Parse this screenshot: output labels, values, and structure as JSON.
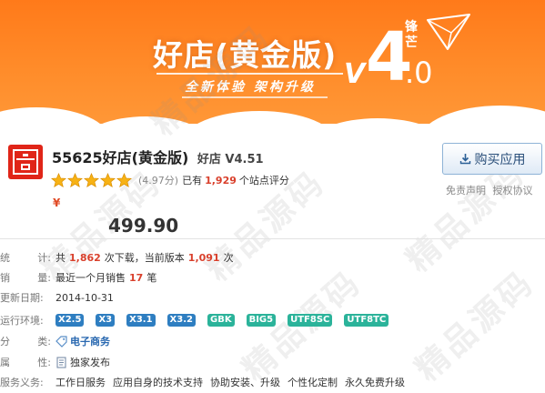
{
  "banner": {
    "title": "好店(黄金版)",
    "subtitle": "全新体验  架构升级",
    "brand": "锋芒",
    "version_v": "V",
    "version_main": "4",
    "version_minor": ".0"
  },
  "watermark": "精品源码",
  "product": {
    "name": "55625好店(黄金版)",
    "subname": "好店 V4.51",
    "rating_stars": 5,
    "score": "(4.97分)",
    "rating_prefix": "已有",
    "rating_count": "1,929",
    "rating_suffix": "个站点评分",
    "price_symbol": "¥",
    "price": "499.90"
  },
  "buy_button": {
    "label": "购买应用"
  },
  "links": {
    "disclaimer": "免责声明",
    "license": "授权协议"
  },
  "info": {
    "stats": {
      "label_a": "统",
      "label_b": "计:",
      "prefix": "共",
      "downloads": "1,862",
      "mid": "次下载，当前版本",
      "version_downloads": "1,091",
      "suffix": "次"
    },
    "sales": {
      "label_a": "销",
      "label_b": "量:",
      "prefix": "最近一个月销售",
      "count": "17",
      "suffix": "笔"
    },
    "updated": {
      "label": "更新日期:",
      "value": "2014-10-31"
    },
    "env": {
      "label": "运行环境:",
      "tags": [
        "X2.5",
        "X3",
        "X3.1",
        "X3.2",
        "GBK",
        "BIG5",
        "UTF8SC",
        "UTF8TC"
      ]
    },
    "category": {
      "label_a": "分",
      "label_b": "类:",
      "value": "电子商务"
    },
    "attribute": {
      "label_a": "属",
      "label_b": "性:",
      "value": "独家发布"
    },
    "service": {
      "label": "服务义务:",
      "items": [
        "工作日服务",
        "应用自身的技术支持",
        "协助安装、升级",
        "个性化定制",
        "永久免费升级"
      ]
    }
  },
  "colors": {
    "banner_orange": "#ff8a28",
    "price_red": "#e04a25",
    "tag_blue": "#2e7ec1",
    "tag_green": "#2bb39a",
    "link_blue": "#2968b0"
  }
}
